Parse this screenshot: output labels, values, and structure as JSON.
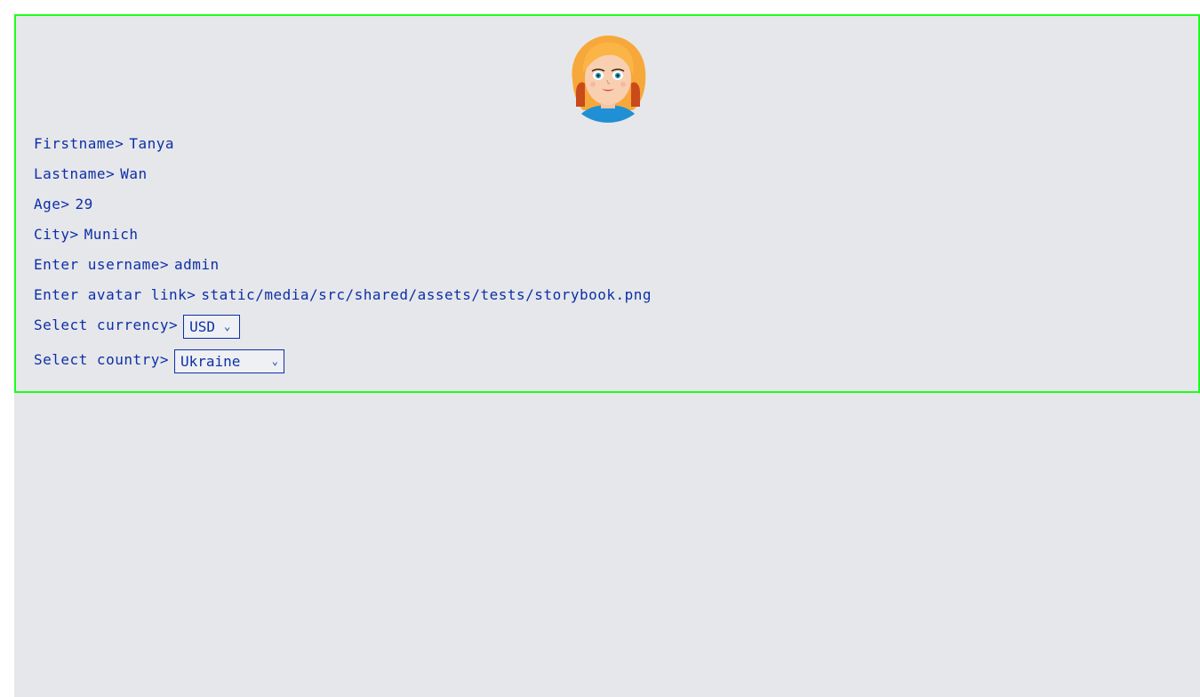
{
  "profile": {
    "firstname_label": "Firstname>",
    "firstname_value": "Tanya",
    "lastname_label": "Lastname>",
    "lastname_value": "Wan",
    "age_label": "Age>",
    "age_value": "29",
    "city_label": "City>",
    "city_value": "Munich",
    "username_label": "Enter username>",
    "username_value": "admin",
    "avatar_label": "Enter avatar link>",
    "avatar_value": "static/media/src/shared/assets/tests/storybook.png",
    "currency_label": "Select currency>",
    "currency_value": "USD",
    "country_label": "Select country>",
    "country_value": "Ukraine"
  },
  "icons": {
    "avatar": "avatar-icon",
    "chevron": "chevron-down-icon"
  },
  "colors": {
    "text": "#0d2fa8",
    "card_border": "#1aff1a",
    "background": "#e6e7ea"
  }
}
